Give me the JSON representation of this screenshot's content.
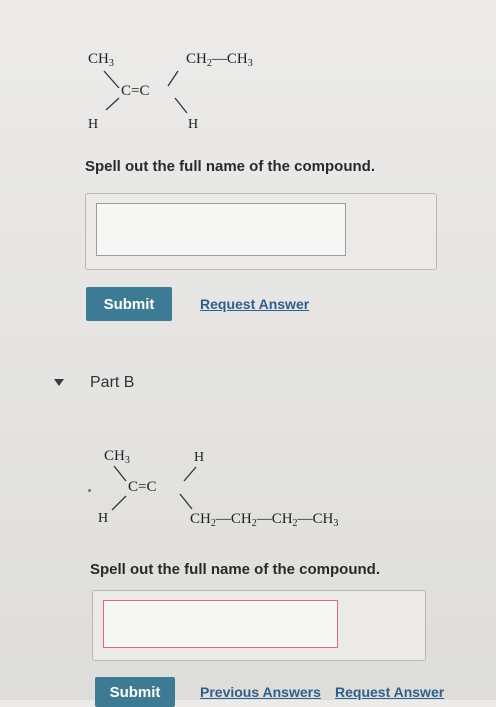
{
  "part_a": {
    "structure": {
      "top_left_group": "CH3",
      "top_right_group": "CH2—CH3",
      "double_bond": "C=C",
      "bottom_left_h": "H",
      "bottom_right_h": "H"
    },
    "prompt": "Spell out the full name of the compound.",
    "answer_value": "",
    "submit_label": "Submit",
    "request_answer_label": "Request Answer"
  },
  "part_b": {
    "title": "Part B",
    "structure": {
      "top_left_group": "CH3",
      "top_right_h": "H",
      "double_bond": "C=C",
      "bottom_left_h": "H",
      "bottom_right_group": "CH2—CH2—CH2—CH3"
    },
    "prompt": "Spell out the full name of the compound.",
    "answer_value": "",
    "submit_label": "Submit",
    "previous_answers_label": "Previous Answers",
    "request_answer_label": "Request Answer"
  },
  "colors": {
    "submit_button": "#3d7a93",
    "link": "#2e5f8c",
    "error_border": "#e0667f"
  }
}
